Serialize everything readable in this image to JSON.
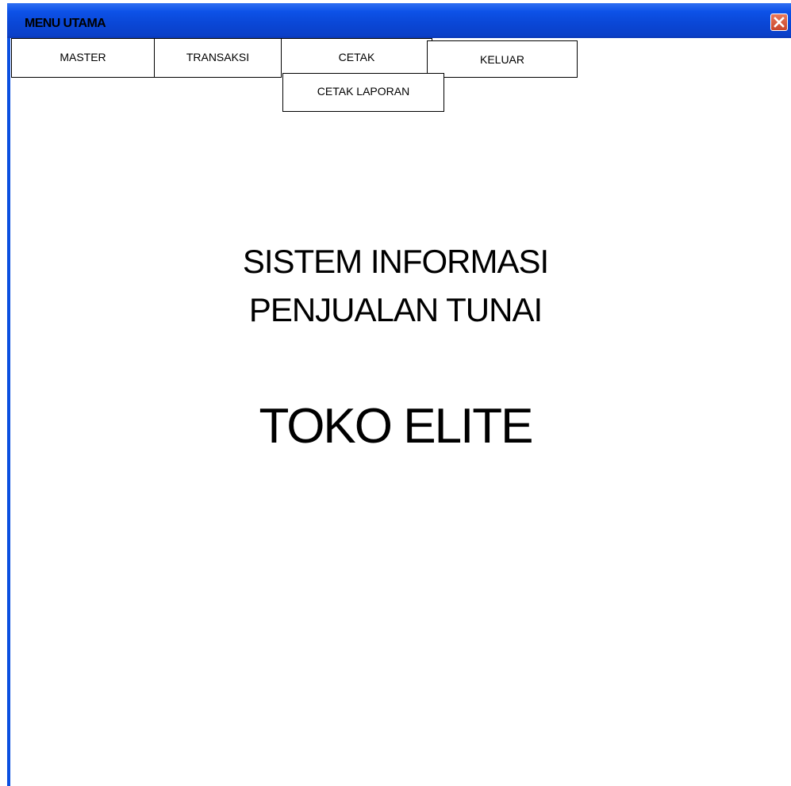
{
  "window": {
    "title": "MENU UTAMA",
    "close_icon": "close-x-icon"
  },
  "menu": {
    "items": [
      {
        "label": "MASTER"
      },
      {
        "label": "TRANSAKSI"
      },
      {
        "label": "CETAK"
      },
      {
        "label": "KELUAR"
      }
    ],
    "cetak_submenu": [
      {
        "label": "CETAK LAPORAN"
      }
    ]
  },
  "content": {
    "line1": "SISTEM INFORMASI",
    "line2": "PENJUALAN TUNAI",
    "store_name": "TOKO ELITE"
  },
  "colors": {
    "titlebar": "#0a47d6",
    "close_button": "#d55a3a"
  }
}
